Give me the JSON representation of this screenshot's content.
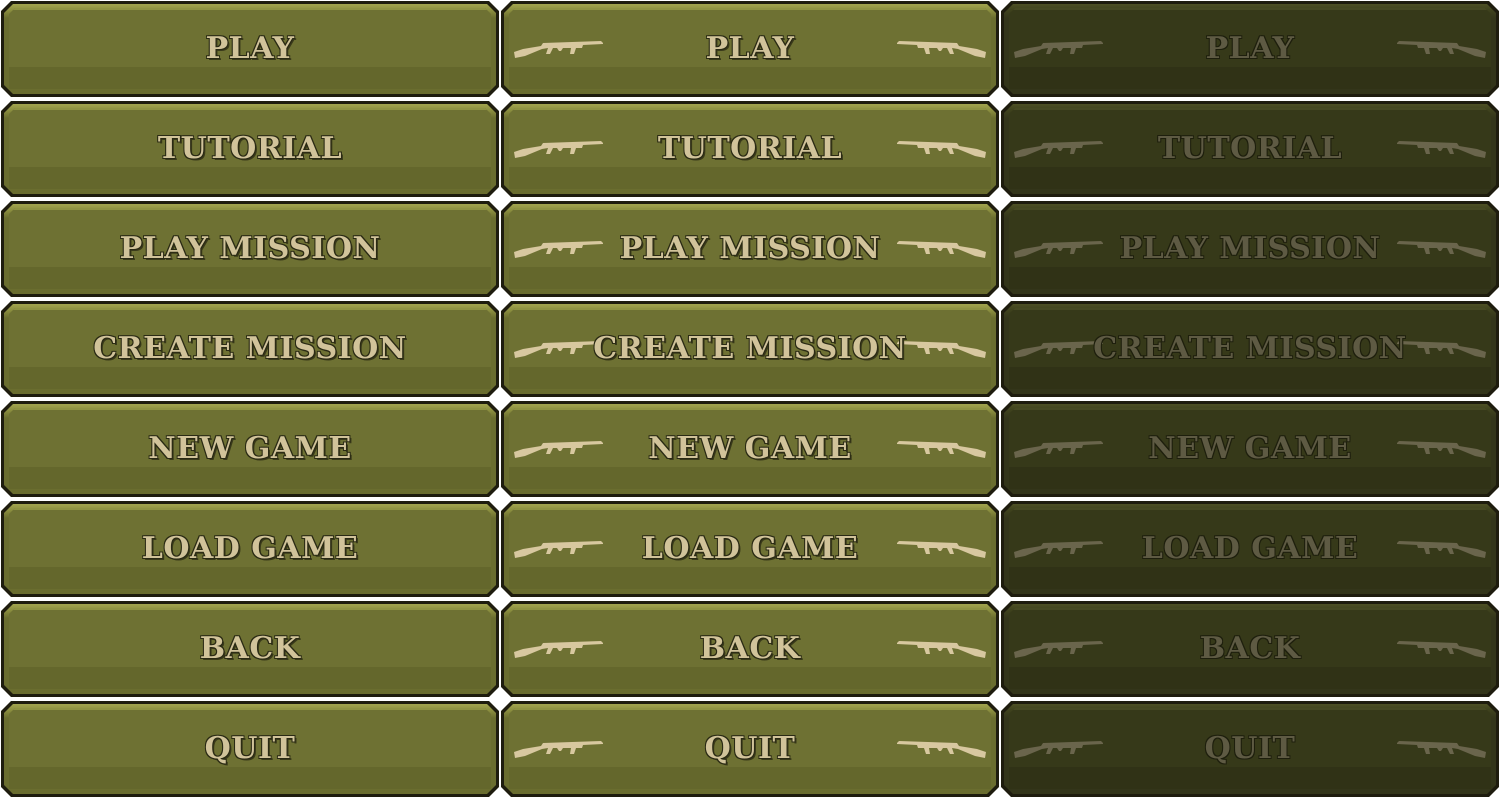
{
  "sheet": {
    "title": "",
    "columns": [
      {
        "state": "normal",
        "has_gun_icons": false
      },
      {
        "state": "hover",
        "has_gun_icons": true
      },
      {
        "state": "disabled",
        "has_gun_icons": true
      }
    ],
    "labels": [
      "PLAY",
      "TUTORIAL",
      "PLAY MISSION",
      "CREATE MISSION",
      "NEW GAME",
      "LOAD GAME",
      "BACK",
      "QUIT"
    ],
    "icons": {
      "left": "tommy-gun-icon",
      "right": "tommy-gun-icon"
    },
    "colors": {
      "normal_face": "#6e7133",
      "disabled_face": "#363919",
      "border": "#1e1c0e",
      "text_normal": "#d1c39a",
      "text_disabled": "#5e5a43",
      "icon_normal": "#d8c8a0",
      "icon_disabled": "#6a654c"
    }
  },
  "rows": [
    {
      "label": "PLAY"
    },
    {
      "label": "TUTORIAL"
    },
    {
      "label": "PLAY MISSION"
    },
    {
      "label": "CREATE MISSION"
    },
    {
      "label": "NEW GAME"
    },
    {
      "label": "LOAD GAME"
    },
    {
      "label": "BACK"
    },
    {
      "label": "QUIT"
    }
  ]
}
